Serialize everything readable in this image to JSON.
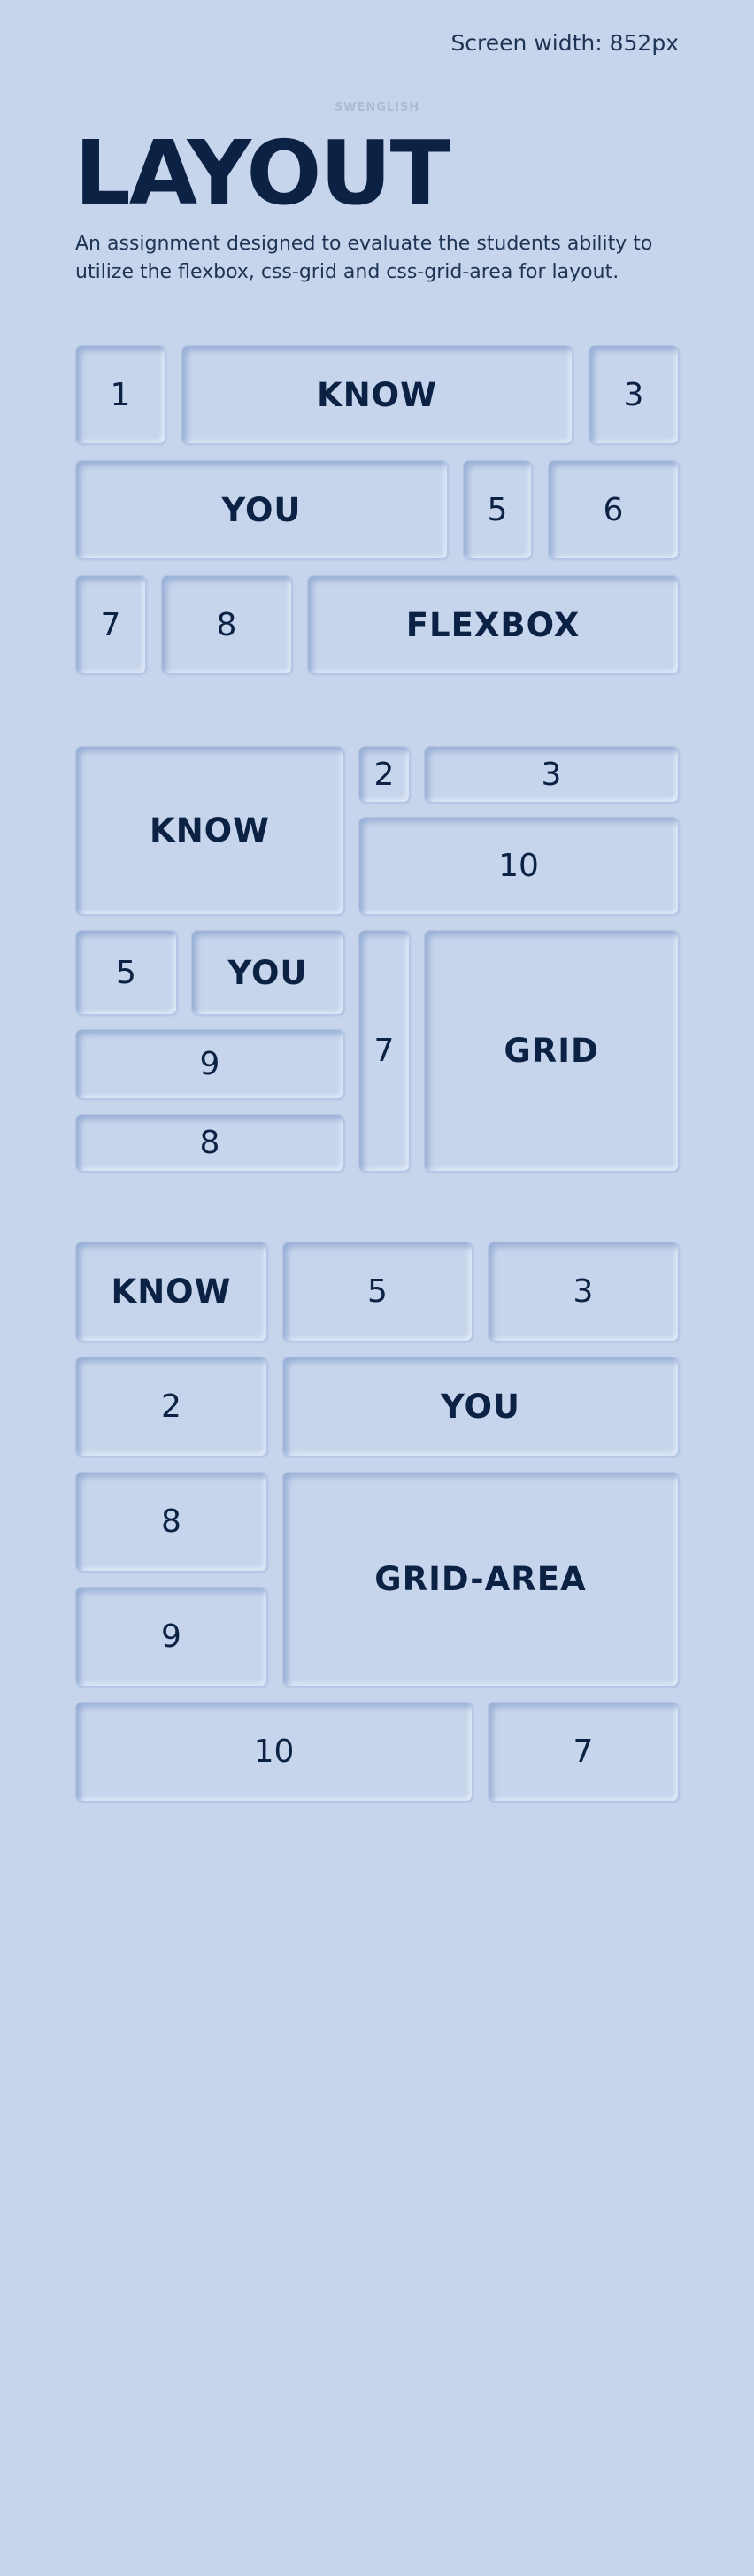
{
  "header": {
    "screen_width": "Screen width: 852px",
    "brand": "SWENGLISH",
    "title": "LAYOUT",
    "subtitle": "An assignment designed to evaluate the students ability to utilize the flexbox, css-grid and css-grid-area for layout."
  },
  "flexbox": {
    "b1": "1",
    "know": "KNOW",
    "b3": "3",
    "you": "YOU",
    "b5": "5",
    "b6": "6",
    "b7": "7",
    "b8": "8",
    "label": "FLEXBOX"
  },
  "grid": {
    "know": "KNOW",
    "b2": "2",
    "b3": "3",
    "b10": "10",
    "b5": "5",
    "you": "YOU",
    "b7": "7",
    "label": "GRID",
    "b9": "9",
    "b8": "8"
  },
  "grid_area": {
    "know": "KNOW",
    "b5": "5",
    "b3": "3",
    "b2": "2",
    "you": "YOU",
    "b8": "8",
    "label": "GRID-AREA",
    "b9": "9",
    "b10": "10",
    "b7": "7"
  }
}
